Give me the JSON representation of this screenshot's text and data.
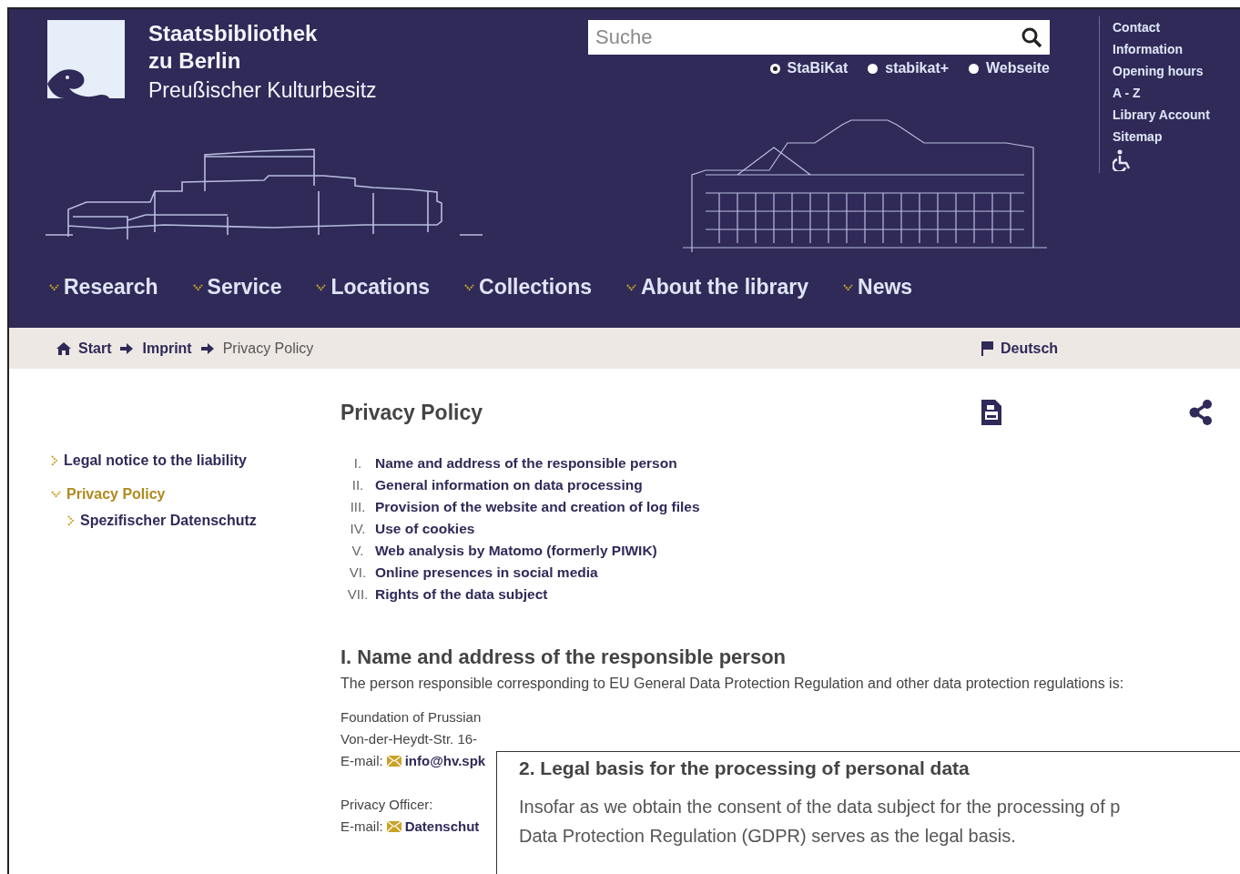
{
  "header": {
    "logo": {
      "line_1": "Staatsbibliothek",
      "line_2": "zu Berlin",
      "line_3": "Preußischer Kulturbesitz"
    },
    "search": {
      "placeholder": "Suche"
    },
    "search_scopes": [
      {
        "label": "StaBiKat",
        "selected": true
      },
      {
        "label": "stabikat+",
        "selected": false
      },
      {
        "label": "Webseite",
        "selected": false
      }
    ],
    "service_links": [
      "Contact",
      "Information",
      "Opening hours",
      "A - Z",
      "Library Account",
      "Sitemap"
    ],
    "nav": [
      "Research",
      "Service",
      "Locations",
      "Collections",
      "About the library",
      "News"
    ]
  },
  "breadcrumb": {
    "items": [
      {
        "label": "Start",
        "kind": "home"
      },
      {
        "label": "Imprint",
        "kind": "link"
      },
      {
        "label": "Privacy Policy",
        "kind": "current"
      }
    ],
    "language": "Deutsch"
  },
  "sidebar": {
    "items": [
      {
        "label": "Legal notice to the liability",
        "selected": false,
        "expanded": false
      },
      {
        "label": "Privacy Policy",
        "selected": true,
        "expanded": true,
        "children": [
          {
            "label": "Spezifischer Datenschutz",
            "selected": false,
            "expanded": false
          }
        ]
      }
    ]
  },
  "page_title": "Privacy Policy",
  "toc": [
    {
      "numeral": "I.",
      "label": "Name and address of the responsible person"
    },
    {
      "numeral": "II.",
      "label": "General information on data processing"
    },
    {
      "numeral": "III.",
      "label": "Provision of the website and creation of log files"
    },
    {
      "numeral": "IV.",
      "label": "Use of cookies"
    },
    {
      "numeral": "V.",
      "label": "Web analysis by Matomo (formerly PIWIK)"
    },
    {
      "numeral": "VI.",
      "label": "Online presences in social media"
    },
    {
      "numeral": "VII.",
      "label": "Rights of the data subject"
    }
  ],
  "section": {
    "heading": "I. Name and address of the responsible person",
    "intro": "The person responsible corresponding to EU General Data Protection Regulation and other data protection regulations is:",
    "address": [
      {
        "kind": "text",
        "text": "Foundation of Prussian"
      },
      {
        "kind": "text",
        "text": "Von-der-Heydt-Str. 16-"
      },
      {
        "kind": "email",
        "label": "E-mail:",
        "link": "info@hv.spk"
      },
      {
        "kind": "gap"
      },
      {
        "kind": "text",
        "text": "Privacy Officer:"
      },
      {
        "kind": "email",
        "label": "E-mail:",
        "link": "Datenschut"
      }
    ]
  },
  "popup": {
    "heading": "2. Legal basis for the processing of personal data",
    "lines": [
      "Insofar as we obtain the consent of the data subject for the processing of p",
      "Data Protection Regulation (GDPR) serves as the legal basis."
    ]
  }
}
